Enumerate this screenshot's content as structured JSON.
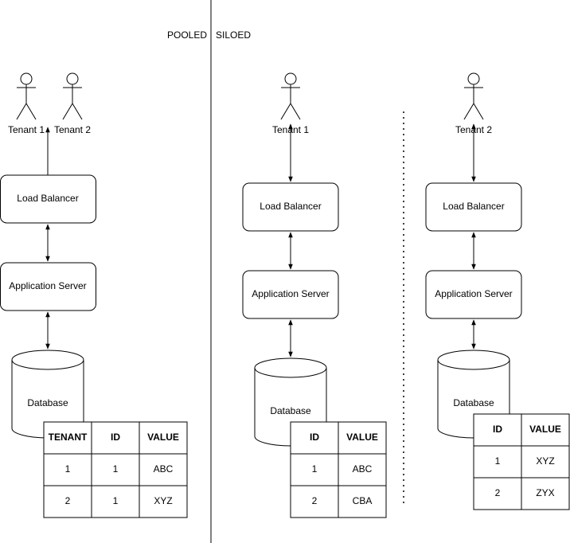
{
  "labels": {
    "pooled": "POOLED",
    "siloed": "SILOED"
  },
  "pooled": {
    "tenants": [
      "Tenant 1",
      "Tenant 2"
    ],
    "load_balancer": "Load Balancer",
    "app_server": "Application Server",
    "database": "Database",
    "table": {
      "headers": [
        "TENANT",
        "ID",
        "VALUE"
      ],
      "rows": [
        [
          "1",
          "1",
          "ABC"
        ],
        [
          "2",
          "1",
          "XYZ"
        ]
      ]
    }
  },
  "siloed": [
    {
      "tenant": "Tenant 1",
      "load_balancer": "Load Balancer",
      "app_server": "Application Server",
      "database": "Database",
      "table": {
        "headers": [
          "ID",
          "VALUE"
        ],
        "rows": [
          [
            "1",
            "ABC"
          ],
          [
            "2",
            "CBA"
          ]
        ]
      }
    },
    {
      "tenant": "Tenant 2",
      "load_balancer": "Load Balancer",
      "app_server": "Application Server",
      "database": "Database",
      "table": {
        "headers": [
          "ID",
          "VALUE"
        ],
        "rows": [
          [
            "1",
            "XYZ"
          ],
          [
            "2",
            "ZYX"
          ]
        ]
      }
    }
  ]
}
